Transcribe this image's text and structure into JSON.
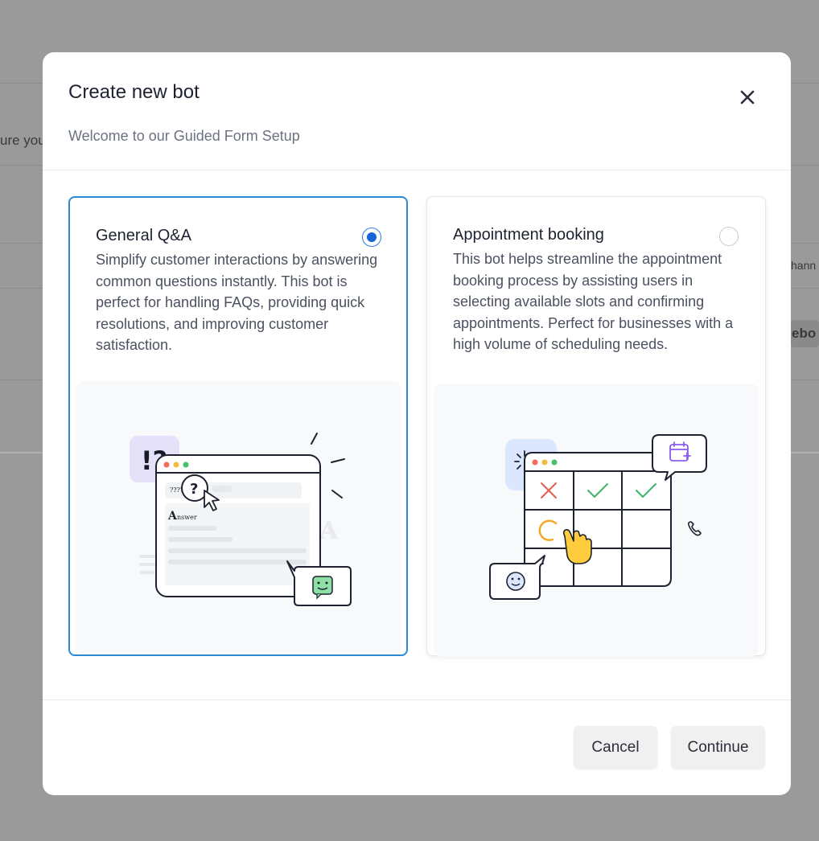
{
  "background": {
    "left_text": "ure you",
    "right_text_1": "hann",
    "right_text_2": "ebo"
  },
  "modal": {
    "title": "Create new bot",
    "subtitle": "Welcome to our Guided Form Setup",
    "close_icon": "close-icon"
  },
  "options": [
    {
      "title": "General Q&A",
      "description": "Simplify customer interactions by answering common questions instantly. This bot is perfect for handling FAQs, providing quick resolutions, and improving customer satisfaction.",
      "selected": true,
      "illustration": {
        "badge": "!?",
        "question_marks": "????",
        "question_glyph": "?",
        "answer_label": "Answer",
        "faded_letter": "A"
      }
    },
    {
      "title": "Appointment booking",
      "description": "This bot helps streamline the appointment booking process by assisting users in selecting available slots and confirming appointments. Perfect for businesses with a high volume of scheduling needs.",
      "selected": false,
      "illustration": {
        "icons": [
          "calendar-add-icon",
          "phone-icon",
          "smiley-icon",
          "pointing-hand-icon",
          "check-icon",
          "cross-icon",
          "loading-icon"
        ]
      }
    }
  ],
  "footer": {
    "cancel_label": "Cancel",
    "continue_label": "Continue"
  },
  "colors": {
    "accent": "#1565d8",
    "selected_border": "#2b8ad6",
    "overlay": "#9a9a9a"
  }
}
